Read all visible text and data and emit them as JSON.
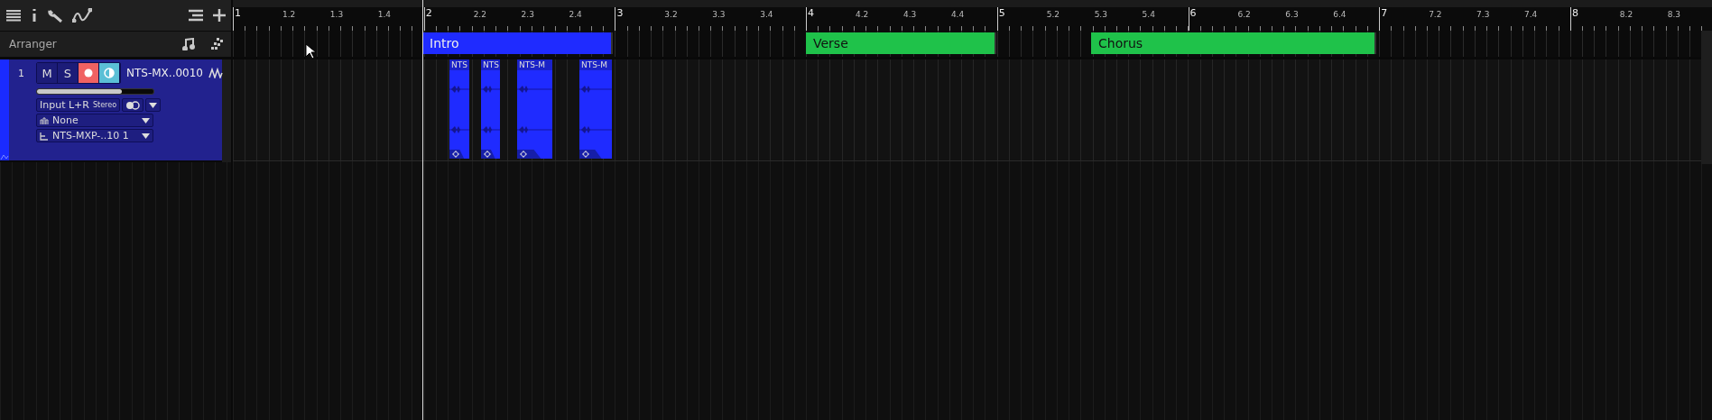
{
  "panel_title": "Arranger",
  "tracks": [
    {
      "number": "1",
      "name": "NTS-MX..0010",
      "mute_label": "M",
      "mute_on": false,
      "solo_label": "S",
      "solo_on": false,
      "record_armed": true,
      "monitor_on": true,
      "level": 0.73,
      "input": "Input L+R",
      "input_mode": "Stereo",
      "stereo_link_on": true,
      "instrument": "None",
      "output": "NTS-MXP-..10 1",
      "clips": [
        {
          "name": "NTS"
        },
        {
          "name": "NTS"
        },
        {
          "name": "NTS-M"
        },
        {
          "name": "NTS-M"
        }
      ]
    }
  ],
  "ruler": {
    "labels": [
      {
        "text": "1",
        "major": true
      },
      {
        "text": "1.2",
        "major": false
      },
      {
        "text": "1.3",
        "major": false
      },
      {
        "text": "1.4",
        "major": false
      },
      {
        "text": "2",
        "major": true
      },
      {
        "text": "2.2",
        "major": false
      },
      {
        "text": "2.3",
        "major": false
      },
      {
        "text": "2.4",
        "major": false
      },
      {
        "text": "3",
        "major": true
      },
      {
        "text": "3.2",
        "major": false
      },
      {
        "text": "3.3",
        "major": false
      },
      {
        "text": "3.4",
        "major": false
      },
      {
        "text": "4",
        "major": true
      },
      {
        "text": "4.2",
        "major": false
      },
      {
        "text": "4.3",
        "major": false
      },
      {
        "text": "4.4",
        "major": false
      },
      {
        "text": "5",
        "major": true
      },
      {
        "text": "5.2",
        "major": false
      },
      {
        "text": "5.3",
        "major": false
      },
      {
        "text": "5.4",
        "major": false
      },
      {
        "text": "6",
        "major": true
      },
      {
        "text": "6.2",
        "major": false
      },
      {
        "text": "6.3",
        "major": false
      },
      {
        "text": "6.4",
        "major": false
      },
      {
        "text": "7",
        "major": true
      },
      {
        "text": "7.2",
        "major": false
      },
      {
        "text": "7.3",
        "major": false
      },
      {
        "text": "7.4",
        "major": false
      },
      {
        "text": "8",
        "major": true
      },
      {
        "text": "8.2",
        "major": false
      },
      {
        "text": "8.3",
        "major": false
      }
    ]
  },
  "markers": [
    {
      "name": "Intro",
      "color": "#1f2bff"
    },
    {
      "name": "Verse",
      "color": "#1fc24a"
    },
    {
      "name": "Chorus",
      "color": "#1fc24a"
    }
  ]
}
